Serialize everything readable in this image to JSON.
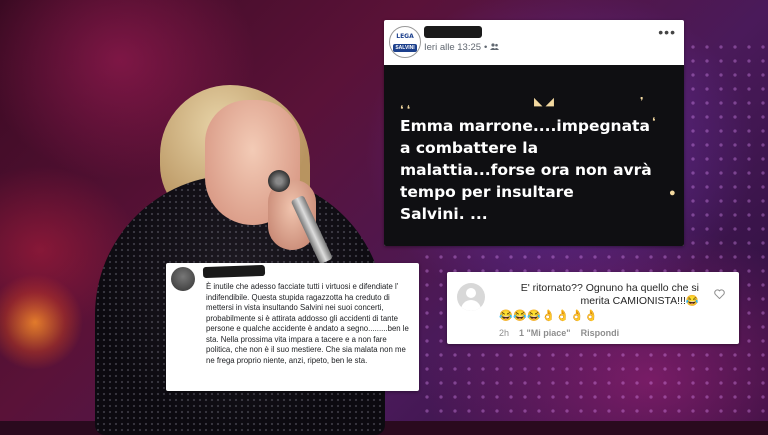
{
  "post": {
    "time": "Ieri alle 13:25",
    "more_icon": "more-horizontal-icon",
    "audience_icon": "friends-icon",
    "logo_top": "LEGA",
    "logo_bottom": "SALVINI",
    "image_text": "Emma marrone....impegnata\na combattere la\nmalattia...forse ora non avrà\ntempo per insultare\nSalvini. ..."
  },
  "comment1": {
    "text": "È inutile che adesso facciate tutti i virtuosi e difendiate l' indifendibile. Questa stupida ragazzotta ha creduto di mettersi in vista insultando Salvini nei suoi concerti, probabilmente si è attirata addosso gli accidenti di tante persone e qualche accidente è andato a segno.........ben le sta. Nella prossima vita impara a tacere e a non fare politica, che non è il suo mestiere. Che sia malata non me ne frega proprio niente, anzi, ripeto, ben le sta."
  },
  "comment2": {
    "text": "E' ritornato?? Ognuno ha quello che si merita CAMIONISTA!!!😂",
    "emojis": "😂😂😂👌👌👌👌",
    "time": "2h",
    "likes": "1 \"Mi piace\"",
    "reply": "Rispondi",
    "heart_icon": "heart-outline-icon"
  }
}
